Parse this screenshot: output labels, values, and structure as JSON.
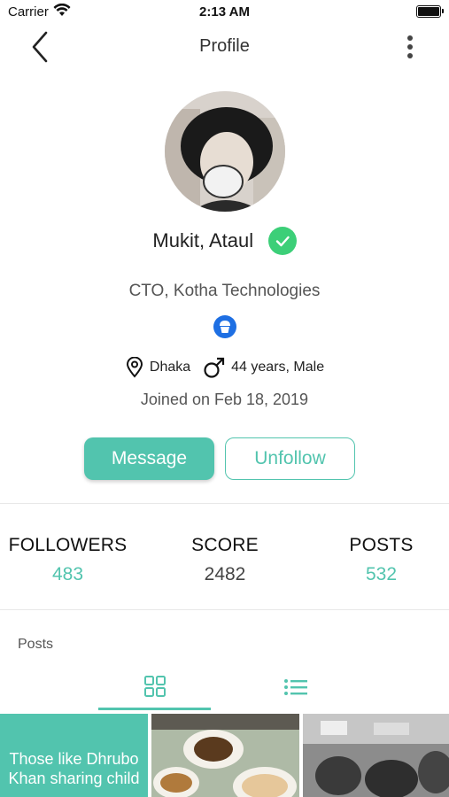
{
  "status_bar": {
    "carrier": "Carrier",
    "time": "2:13 AM"
  },
  "navbar": {
    "title": "Profile"
  },
  "profile": {
    "name": "Mukit, Ataul",
    "title": "CTO, Kotha Technologies",
    "location": "Dhaka",
    "age_gender": "44 years, Male",
    "joined": "Joined on Feb 18, 2019"
  },
  "actions": {
    "message": "Message",
    "unfollow": "Unfollow"
  },
  "stats": {
    "followers_label": "FOLLOWERS",
    "followers_value": "483",
    "score_label": "SCORE",
    "score_value": "2482",
    "posts_label": "POSTS",
    "posts_value": "532"
  },
  "posts_section": {
    "label": "Posts"
  },
  "tiles": [
    {
      "text": "Those like Dhrubo Khan sharing child"
    }
  ],
  "colors": {
    "accent": "#52c4ae",
    "verified": "#3ccf78",
    "badge": "#1e6fe3"
  },
  "icons": [
    "wifi-icon",
    "battery-icon",
    "back-icon",
    "more-icon",
    "check-icon",
    "badge-icon",
    "location-icon",
    "male-icon",
    "grid-icon",
    "list-icon"
  ]
}
